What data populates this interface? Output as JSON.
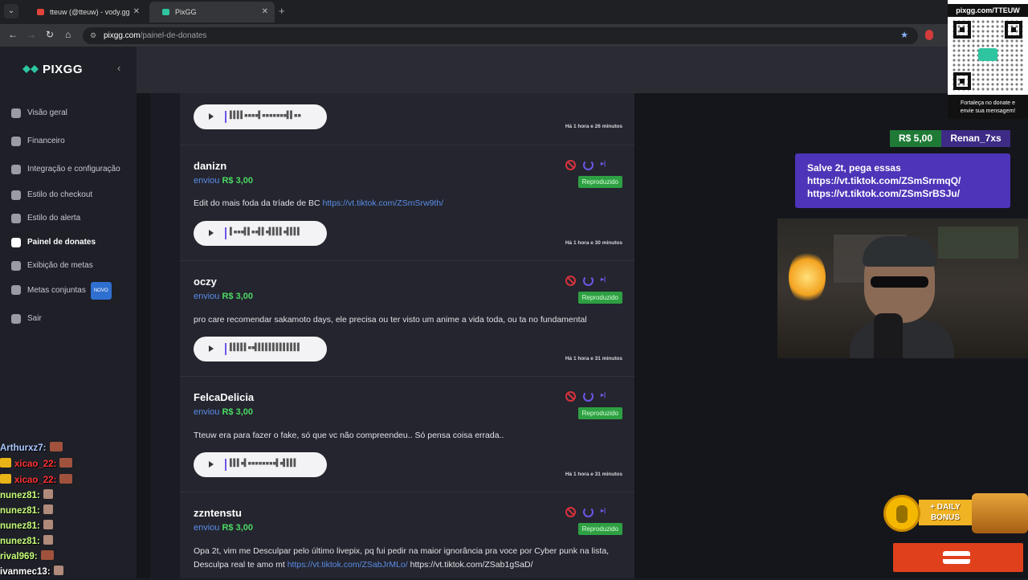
{
  "browser": {
    "tabs": [
      {
        "title": "tteuw (@tteuw) - vody.gg",
        "favicon_color": "#e0443a"
      },
      {
        "title": "PixGG",
        "favicon_color": "#2ec5a0"
      }
    ],
    "url_site": "pixgg.com",
    "url_path": "/painel-de-donates"
  },
  "sidebar": {
    "brand": "PIXGG",
    "items": [
      {
        "label": "Visão geral",
        "icon": "home-icon"
      },
      {
        "label": "Financeiro",
        "icon": "wallet-icon"
      },
      {
        "label": "Integração e configuração",
        "icon": "settings-icon"
      },
      {
        "label": "Estilo do checkout",
        "icon": "palette-icon"
      },
      {
        "label": "Estilo do alerta",
        "icon": "palette-icon"
      },
      {
        "label": "Painel de donates",
        "icon": "donate-icon",
        "active": true
      },
      {
        "label": "Exibição de metas",
        "icon": "star-icon"
      },
      {
        "label": "Metas conjuntas",
        "icon": "target-icon",
        "badge": "NOVO"
      },
      {
        "label": "Sair",
        "icon": "logout-icon"
      }
    ]
  },
  "donations": [
    {
      "time": "Há 1 hora e 26 minutos"
    },
    {
      "name": "danizn",
      "verb": "enviou",
      "amount": "R$ 3,00",
      "status": "Reproduzido",
      "message": "Edit do mais foda da tríade de BC ",
      "link": "https://vt.tiktok.com/ZSmSrw9th/",
      "time": "Há 1 hora e 30 minutos"
    },
    {
      "name": "oczy",
      "verb": "enviou",
      "amount": "R$ 3,00",
      "status": "Reproduzido",
      "message": "pro care recomendar sakamoto days, ele precisa ou ter visto um anime a vida toda, ou ta no fundamental",
      "time": "Há 1 hora e 31 minutos"
    },
    {
      "name": "FelcaDelicia",
      "verb": "enviou",
      "amount": "R$ 3,00",
      "status": "Reproduzido",
      "message": "Tteuw era para fazer o fake, só que vc não compreendeu.. Só pensa coisa errada..",
      "time": "Há 1 hora e 31 minutos"
    },
    {
      "name": "zzntenstu",
      "verb": "enviou",
      "amount": "R$ 3,00",
      "status": "Reproduzido",
      "message_a": "Opa 2t, vim me Desculpar pelo último livepix, pq fui pedir na maior ignorância pra voce por Cyber punk na lista, Desculpa real te amo mt ",
      "link": "https://vt.tiktok.com/ZSabJrMLo/",
      "message_b": " https://vt.tiktok.com/ZSab1gSaD/"
    }
  ],
  "overlay": {
    "qr_title": "pixgg.com/TTEUW",
    "qr_caption_1": "Fortaleça no donate e",
    "qr_caption_2": "envie sua mensagem!",
    "alert_amount": "R$ 5,00",
    "alert_user": "Renan_7xs",
    "alert_line1": "Salve 2t, pega essas",
    "alert_line2": "https://vt.tiktok.com/ZSmSrrmqQ/",
    "alert_line3": "https://vt.tiktok.com/ZSmSrBSJu/",
    "bonus_line1": "+ DAILY",
    "bonus_line2": "BONUS"
  },
  "chat": [
    {
      "user": "Arthurxz7:",
      "color": "#a8c8ff",
      "crown": false
    },
    {
      "user": "xicao_22:",
      "color": "#ff3030",
      "crown": true
    },
    {
      "user": "xicao_22:",
      "color": "#ff3030",
      "crown": true
    },
    {
      "user": "nunez81:",
      "color": "#c8ff7a",
      "crown": false
    },
    {
      "user": "nunez81:",
      "color": "#c8ff7a",
      "crown": false
    },
    {
      "user": "nunez81:",
      "color": "#c8ff7a",
      "crown": false
    },
    {
      "user": "nunez81:",
      "color": "#c8ff7a",
      "crown": false
    },
    {
      "user": "rival969:",
      "color": "#c8ff7a",
      "crown": false
    },
    {
      "user": "ivanmec13:",
      "color": "#ffffff",
      "crown": false
    }
  ]
}
